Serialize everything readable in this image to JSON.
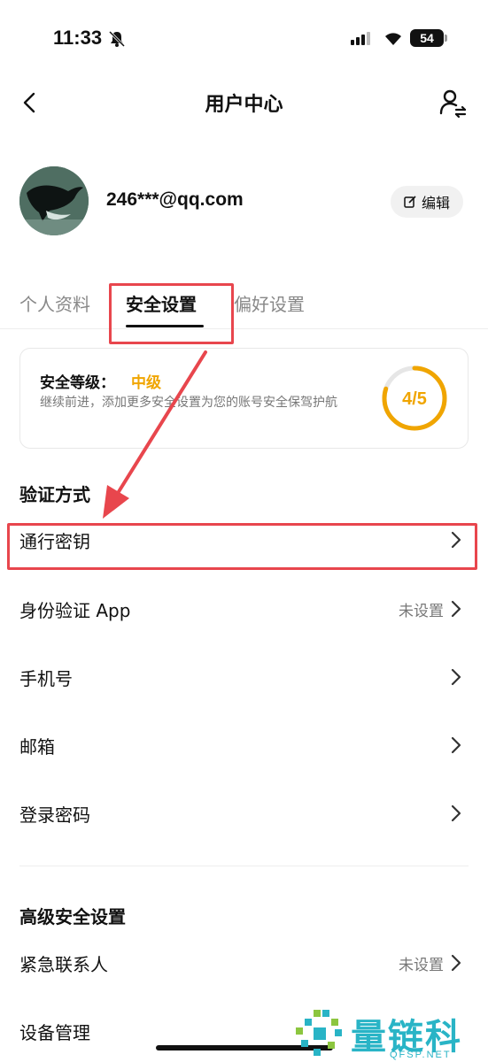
{
  "status_bar": {
    "time": "11:33",
    "battery": "54"
  },
  "nav": {
    "title": "用户中心"
  },
  "profile": {
    "email": "246***@qq.com",
    "edit_label": "编辑"
  },
  "tabs": [
    {
      "label": "个人资料"
    },
    {
      "label": "安全设置"
    },
    {
      "label": "偏好设置"
    }
  ],
  "security": {
    "label": "安全等级：",
    "level": "中级",
    "description": "继续前进，添加更多安全设置为您的账号安全保驾护航",
    "score": "4/5",
    "score_fraction": 0.8
  },
  "sections": {
    "verification_title": "验证方式",
    "advanced_title": "高级安全设置"
  },
  "verification_rows": [
    {
      "label": "通行密钥",
      "value": ""
    },
    {
      "label": "身份验证 App",
      "value": "未设置"
    },
    {
      "label": "手机号",
      "value": ""
    },
    {
      "label": "邮箱",
      "value": ""
    },
    {
      "label": "登录密码",
      "value": ""
    }
  ],
  "advanced_rows": [
    {
      "label": "紧急联系人",
      "value": "未设置"
    },
    {
      "label": "设备管理",
      "value": ""
    }
  ],
  "watermark": {
    "text": "量链科技",
    "sub": "QFSP.NET"
  },
  "colors": {
    "accent": "#f0a500",
    "highlight": "#e8464d",
    "watermark": "#29b4c6"
  }
}
